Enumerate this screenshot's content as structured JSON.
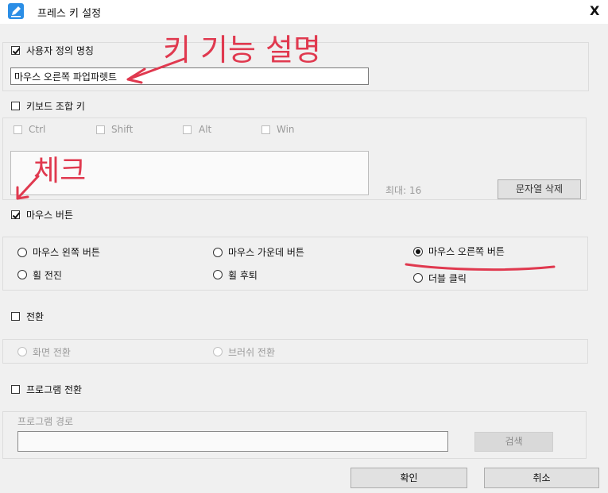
{
  "window": {
    "title": "프레스 키 설정",
    "close_glyph": "X"
  },
  "custom_name": {
    "label": "사용자 정의 명칭",
    "checked": true,
    "value": "마우스 오른쪽 파업파렛트"
  },
  "keyboard": {
    "label": "키보드 조합 키",
    "checked": false,
    "modifiers": [
      "Ctrl",
      "Shift",
      "Alt",
      "Win"
    ],
    "max_label": "최대: 16",
    "delete_button": "문자열 삭제"
  },
  "mouse": {
    "label": "마우스 버튼",
    "checked": true,
    "options": [
      {
        "label": "마우스 왼쪽 버튼",
        "selected": false
      },
      {
        "label": "마우스 가운데 버튼",
        "selected": false
      },
      {
        "label": "마우스 오른쪽 버튼",
        "selected": true
      },
      {
        "label": "휠 전진",
        "selected": false
      },
      {
        "label": "휠 후퇴",
        "selected": false
      },
      {
        "label": "더블 클릭",
        "selected": false
      }
    ]
  },
  "switch": {
    "label": "전환",
    "checked": false,
    "options": [
      "화면 전환",
      "브러쉬 전환"
    ]
  },
  "program_switch": {
    "label": "프로그램 전환",
    "checked": false,
    "path_label": "프로그램 경로",
    "search_button": "검색"
  },
  "footer": {
    "ok_button": "확인",
    "cancel_button": "취소"
  },
  "annotations": {
    "key_function": "키 기능 설명",
    "check": "체크",
    "color": "#e0394f"
  }
}
